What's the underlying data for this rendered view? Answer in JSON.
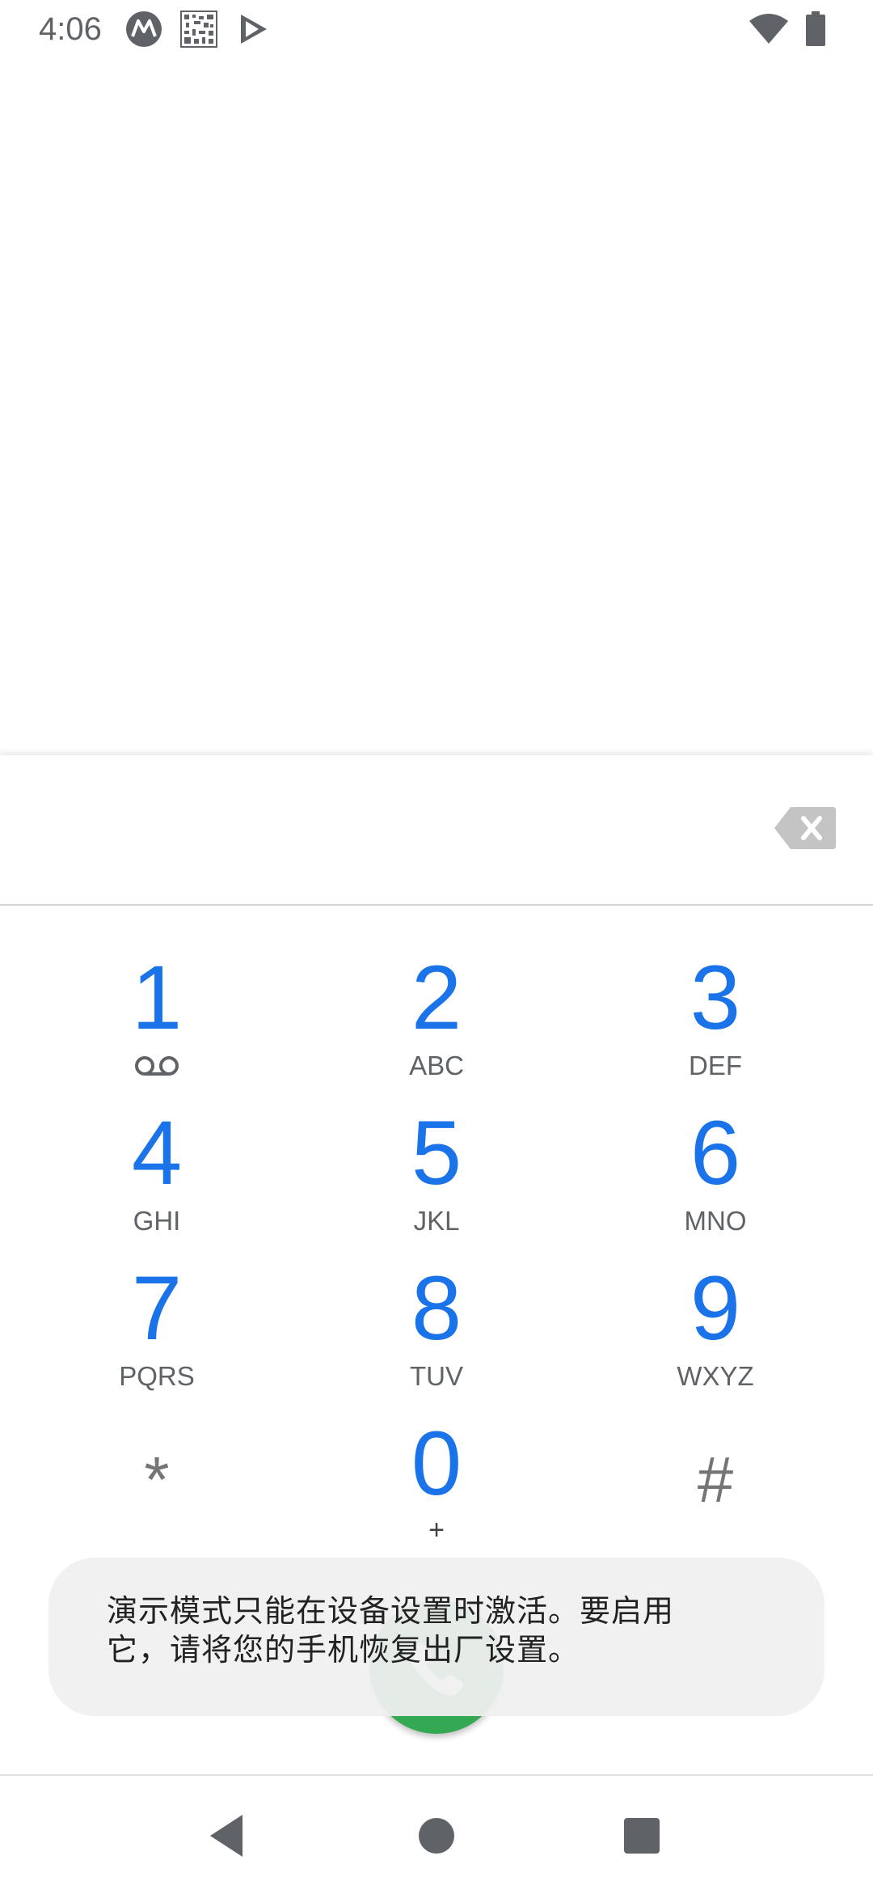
{
  "status_bar": {
    "time": "4:06",
    "icons": [
      "motorola-icon",
      "qr-code-icon",
      "play-store-icon",
      "wifi-icon",
      "battery-icon"
    ]
  },
  "dialpad": {
    "digits_value": "",
    "backspace_icon": "backspace-icon",
    "keys": [
      {
        "digit": "1",
        "letters": "",
        "icon": "voicemail-icon"
      },
      {
        "digit": "2",
        "letters": "ABC"
      },
      {
        "digit": "3",
        "letters": "DEF"
      },
      {
        "digit": "4",
        "letters": "GHI"
      },
      {
        "digit": "5",
        "letters": "JKL"
      },
      {
        "digit": "6",
        "letters": "MNO"
      },
      {
        "digit": "7",
        "letters": "PQRS"
      },
      {
        "digit": "8",
        "letters": "TUV"
      },
      {
        "digit": "9",
        "letters": "WXYZ"
      },
      {
        "digit": "*",
        "letters": ""
      },
      {
        "digit": "0",
        "letters": "+"
      },
      {
        "digit": "#",
        "letters": ""
      }
    ],
    "call_button_color": "#34a853",
    "digit_color": "#1a73e8"
  },
  "toast": {
    "line1": "演示模式只能在设备设置时激活。要启用",
    "line2": "它，请将您的手机恢复出厂设置。"
  },
  "nav_bar": {
    "icons": [
      "back-icon",
      "home-icon",
      "recents-icon"
    ]
  }
}
